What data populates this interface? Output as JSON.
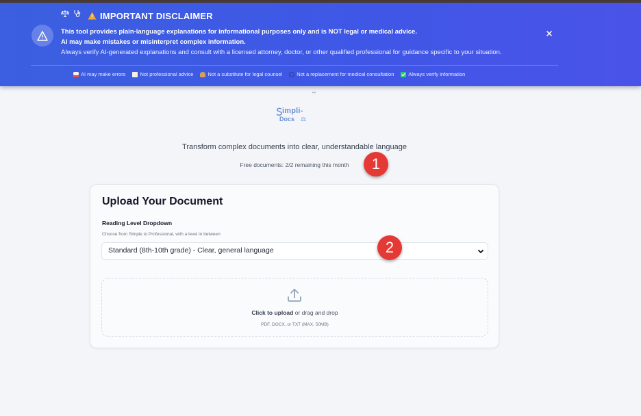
{
  "banner": {
    "title": "IMPORTANT DISCLAIMER",
    "line1": "This tool provides plain-language explanations for informational purposes only and is NOT legal or medical advice.",
    "line2": "AI may make mistakes or misinterpret complex information.",
    "line3": "Always verify AI-generated explanations and consult with a licensed attorney, doctor, or other qualified professional for guidance specific to your situation.",
    "tags": [
      {
        "icon": "robot-icon",
        "label": "AI may make errors"
      },
      {
        "icon": "clipboard-icon",
        "label": "Not professional advice"
      },
      {
        "icon": "scales-icon",
        "label": "Not a substitute for legal counsel"
      },
      {
        "icon": "stethoscope-icon",
        "label": "Not a replacement for medical consultation"
      },
      {
        "icon": "checkmark-icon",
        "label": "Always verify information"
      }
    ],
    "colors": {
      "background": "#3f57e6",
      "warning": "#f5a623",
      "check": "#2ecc71"
    }
  },
  "brand": {
    "trademark": "™",
    "logo_line1": "impli-",
    "logo_line2": "Docs"
  },
  "hero": {
    "subtitle": "Transform complex documents into clear, understandable language",
    "free_docs": "Free documents: 2/2 remaining this month"
  },
  "markers": [
    "1",
    "2"
  ],
  "upload": {
    "title": "Upload Your Document",
    "reading_level_label": "Reading Level Dropdown",
    "reading_level_hint": "Choose from Simple to Professional, with a level in between",
    "selected_level": "Standard (8th-10th grade) - Clear, general language",
    "dropzone_click": "Click to upload",
    "dropzone_rest": " or drag and drop",
    "dropzone_formats": "PDF, DOCX, or TXT (MAX. 50MB)"
  }
}
